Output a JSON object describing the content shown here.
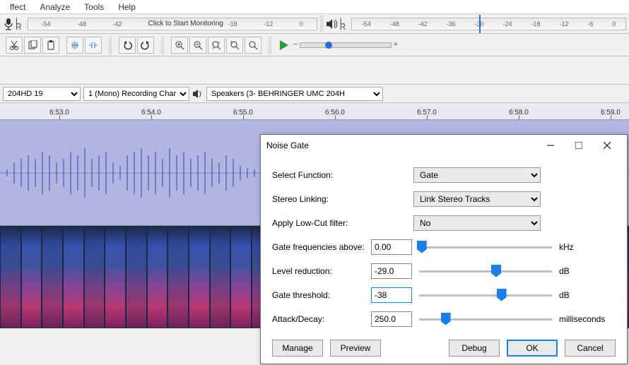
{
  "menu": {
    "items": [
      "ffect",
      "Analyze",
      "Tools",
      "Help"
    ]
  },
  "meters": {
    "mic": {
      "ticks": [
        "-54",
        "-48",
        "-42"
      ],
      "monitor_text": "Click to Start Monitoring",
      "ticks2": [
        "-18",
        "-12",
        "0"
      ]
    },
    "spk": {
      "ticks": [
        "-54",
        "-48",
        "-42",
        "-36",
        "-30",
        "-24",
        "-18",
        "-12",
        "-6",
        "0"
      ]
    }
  },
  "devices": {
    "input": "204HD 19",
    "channels": "1 (Mono) Recording Char",
    "output": "Speakers (3- BEHRINGER UMC 204H"
  },
  "timeline": {
    "ticks": [
      {
        "label": "6:53.0",
        "pos": 70
      },
      {
        "label": "6:54.0",
        "pos": 200
      },
      {
        "label": "6:55.0",
        "pos": 330
      },
      {
        "label": "6:56.0",
        "pos": 460
      },
      {
        "label": "6:57.0",
        "pos": 590
      },
      {
        "label": "6:58.0",
        "pos": 720
      },
      {
        "label": "6:59.0",
        "pos": 850
      }
    ]
  },
  "dialog": {
    "title": "Noise Gate",
    "rows": {
      "select_function": {
        "label": "Select Function:",
        "value": "Gate"
      },
      "stereo_linking": {
        "label": "Stereo Linking:",
        "value": "Link Stereo Tracks"
      },
      "low_cut": {
        "label": "Apply Low-Cut filter:",
        "value": "No"
      },
      "freq": {
        "label": "Gate frequencies above:",
        "value": "0.00",
        "unit": "kHz",
        "thumb_pct": 2
      },
      "level": {
        "label": "Level reduction:",
        "value": "-29.0",
        "unit": "dB",
        "thumb_pct": 58
      },
      "threshold": {
        "label": "Gate threshold:",
        "value": "-38",
        "unit": "dB",
        "thumb_pct": 62
      },
      "attack": {
        "label": "Attack/Decay:",
        "value": "250.0",
        "unit": "milliseconds",
        "thumb_pct": 20
      }
    },
    "buttons": {
      "manage": "Manage",
      "preview": "Preview",
      "debug": "Debug",
      "ok": "OK",
      "cancel": "Cancel"
    }
  }
}
